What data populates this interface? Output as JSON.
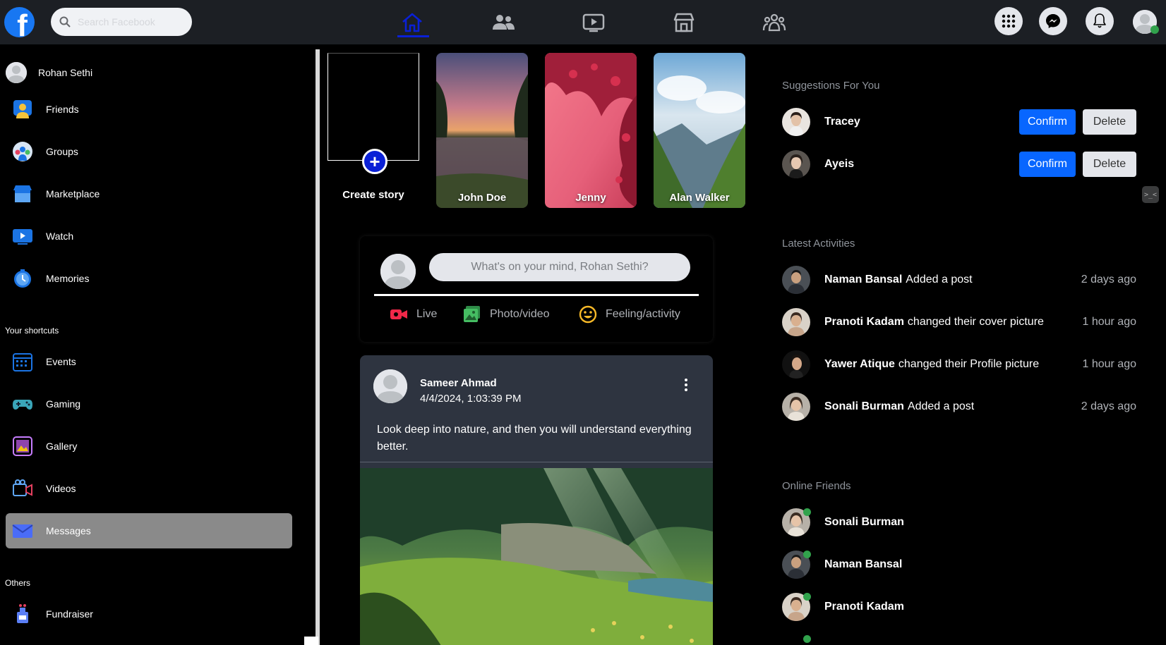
{
  "topbar": {
    "logo_letter": "f",
    "search_placeholder": "Search Facebook",
    "nav": [
      "home-icon",
      "friends-icon",
      "watch-icon",
      "marketplace-icon",
      "groups-icon"
    ],
    "active_nav": "home-icon",
    "right_buttons": [
      "menu-grid-icon",
      "messenger-icon",
      "bell-icon",
      "profile-avatar"
    ]
  },
  "sidebar": {
    "profile_name": "Rohan Sethi",
    "items": [
      {
        "label": "Friends",
        "icon": "friends-icon"
      },
      {
        "label": "Groups",
        "icon": "groups-icon"
      },
      {
        "label": "Marketplace",
        "icon": "marketplace-icon"
      },
      {
        "label": "Watch",
        "icon": "watch-icon"
      },
      {
        "label": "Memories",
        "icon": "memories-icon"
      }
    ],
    "shortcuts_heading": "Your shortcuts",
    "shortcuts": [
      {
        "label": "Events",
        "icon": "calendar-icon"
      },
      {
        "label": "Gaming",
        "icon": "gamepad-icon"
      },
      {
        "label": "Gallery",
        "icon": "gallery-icon"
      },
      {
        "label": "Videos",
        "icon": "video-camera-icon"
      },
      {
        "label": "Messages",
        "icon": "mail-icon",
        "active": true
      }
    ],
    "others_heading": "Others",
    "others": [
      {
        "label": "Fundraiser",
        "icon": "fundraiser-icon"
      }
    ]
  },
  "stories": {
    "create_label": "Create story",
    "create_plus": "+",
    "items": [
      {
        "name": "John Doe"
      },
      {
        "name": "Jenny"
      },
      {
        "name": "Alan Walker"
      }
    ]
  },
  "composer": {
    "placeholder": "What's on your mind, Rohan Sethi?",
    "actions": [
      {
        "label": "Live",
        "icon": "live-video-icon",
        "color": "#f02849"
      },
      {
        "label": "Photo/video",
        "icon": "photo-icon",
        "color": "#45bd62"
      },
      {
        "label": "Feeling/activity",
        "icon": "smiley-icon",
        "color": "#f7b928"
      }
    ]
  },
  "post": {
    "author": "Sameer Ahmad",
    "timestamp": "4/4/2024, 1:03:39 PM",
    "text": "Look deep into nature, and then you will understand everything better."
  },
  "suggestions": {
    "heading": "Suggestions For You",
    "confirm_label": "Confirm",
    "delete_label": "Delete",
    "people": [
      {
        "name": "Tracey"
      },
      {
        "name": "Ayeis"
      }
    ]
  },
  "activities": {
    "heading": "Latest Activities",
    "items": [
      {
        "name": "Naman Bansal",
        "action": "Added a post",
        "when": "2 days ago"
      },
      {
        "name": "Pranoti Kadam",
        "action": "changed their cover picture",
        "when": "1 hour ago"
      },
      {
        "name": "Yawer Atique",
        "action": "changed their Profile picture",
        "when": "1 hour ago"
      },
      {
        "name": "Sonali Burman",
        "action": "Added a post",
        "when": "2 days ago"
      }
    ]
  },
  "online": {
    "heading": "Online Friends",
    "friends": [
      {
        "name": "Sonali Burman"
      },
      {
        "name": "Naman Bansal"
      },
      {
        "name": "Pranoti Kadam"
      }
    ]
  },
  "colors": {
    "brand": "#1877f2",
    "accent_nav": "#0a20d6",
    "confirm": "#0866ff",
    "online": "#31a24c"
  }
}
